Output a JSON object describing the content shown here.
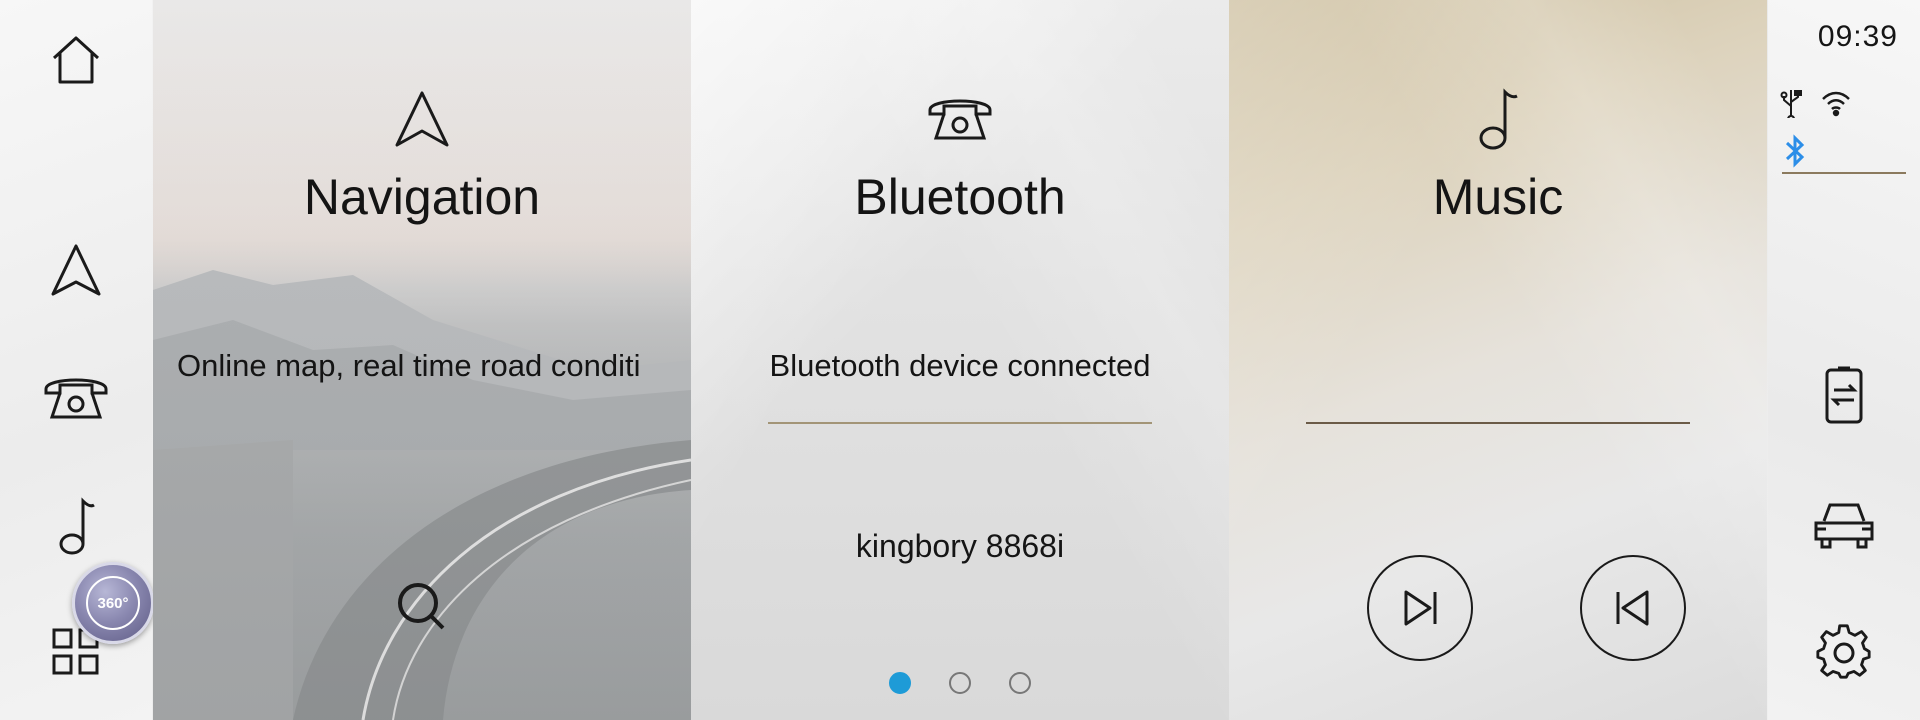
{
  "status": {
    "time": "09:39",
    "bluetooth_color": "#2c8ee8"
  },
  "left_nav": [
    {
      "icon": "home-icon"
    },
    {
      "icon": "navigation-arrow-icon"
    },
    {
      "icon": "telephone-icon"
    },
    {
      "icon": "music-note-icon"
    },
    {
      "icon": "apps-grid-icon"
    }
  ],
  "btn360_label": "360°",
  "cards": {
    "navigation": {
      "title": "Navigation",
      "description": "Online map, real time road conditi"
    },
    "bluetooth": {
      "title": "Bluetooth",
      "description": "Bluetooth device connected",
      "device_name": "kingbory 8868i"
    },
    "music": {
      "title": "Music"
    }
  },
  "pager": {
    "count": 3,
    "active_index": 0,
    "active_color": "#1e9bd7"
  },
  "right_nav": [
    {
      "icon": "phone-link-icon"
    },
    {
      "icon": "car-icon"
    },
    {
      "icon": "settings-gear-icon"
    }
  ]
}
